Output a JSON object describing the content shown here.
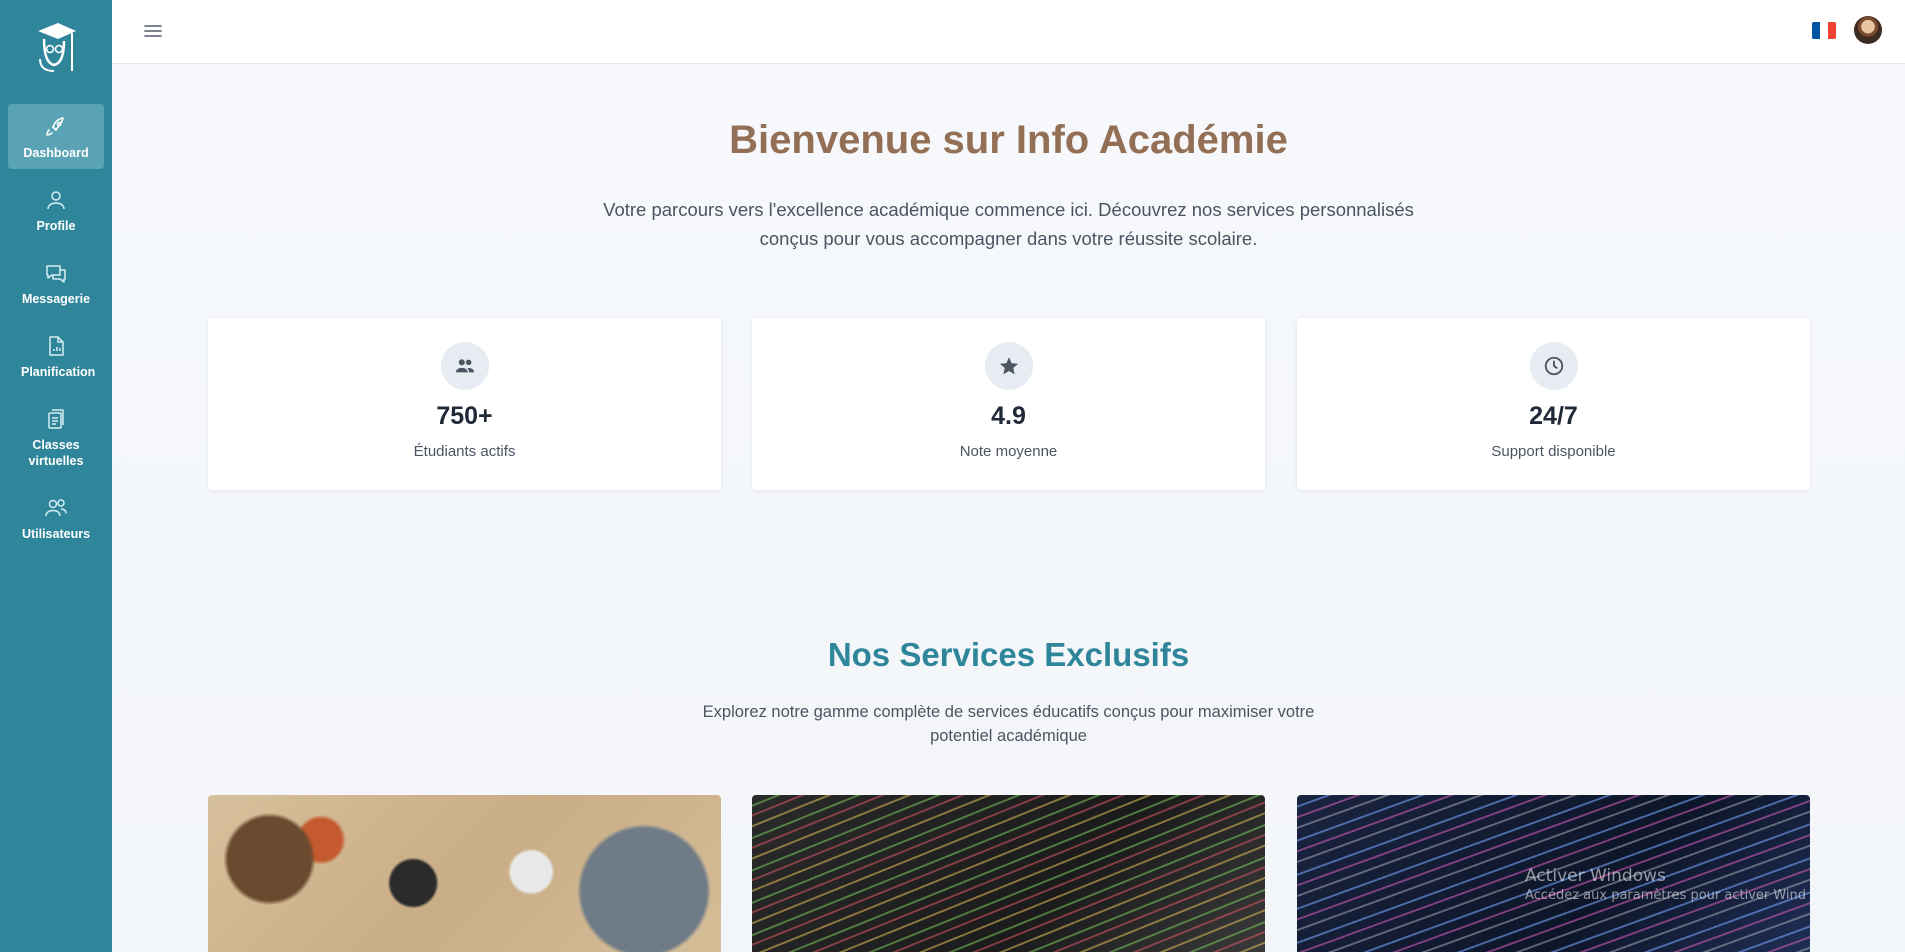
{
  "sidebar": {
    "logo_icon": "graduate-cap-logo",
    "items": [
      {
        "label": "Dashboard",
        "icon": "rocket-icon",
        "active": true
      },
      {
        "label": "Profile",
        "icon": "user-icon"
      },
      {
        "label": "Messagerie",
        "icon": "chat-icon"
      },
      {
        "label": "Planification",
        "icon": "document-chart-icon"
      },
      {
        "label": "Classes virtuelles",
        "icon": "clipboard-icon"
      },
      {
        "label": "Utilisateurs",
        "icon": "users-icon"
      }
    ]
  },
  "header": {
    "menu_icon": "hamburger-icon",
    "language_flag": "france-flag",
    "avatar": "user-avatar"
  },
  "hero": {
    "title": "Bienvenue sur Info Académie",
    "subtitle": "Votre parcours vers l'excellence académique commence ici. Découvrez nos services personnalisés conçus pour vous accompagner dans votre réussite scolaire."
  },
  "stats": [
    {
      "value": "750+",
      "label": "Étudiants actifs",
      "icon": "people-icon"
    },
    {
      "value": "4.9",
      "label": "Note moyenne",
      "icon": "star-icon"
    },
    {
      "value": "24/7",
      "label": "Support disponible",
      "icon": "clock-icon"
    }
  ],
  "services": {
    "title": "Nos Services Exclusifs",
    "subtitle": "Explorez notre gamme complète de services éducatifs conçus pour maximiser votre potentiel académique"
  },
  "watermark": {
    "line1": "Activer Windows",
    "line2": "Accédez aux paramètres pour activer Wind"
  },
  "colors": {
    "sidebar": "#2f869b",
    "hero_title": "#936f55",
    "section_title": "#2f869b"
  }
}
